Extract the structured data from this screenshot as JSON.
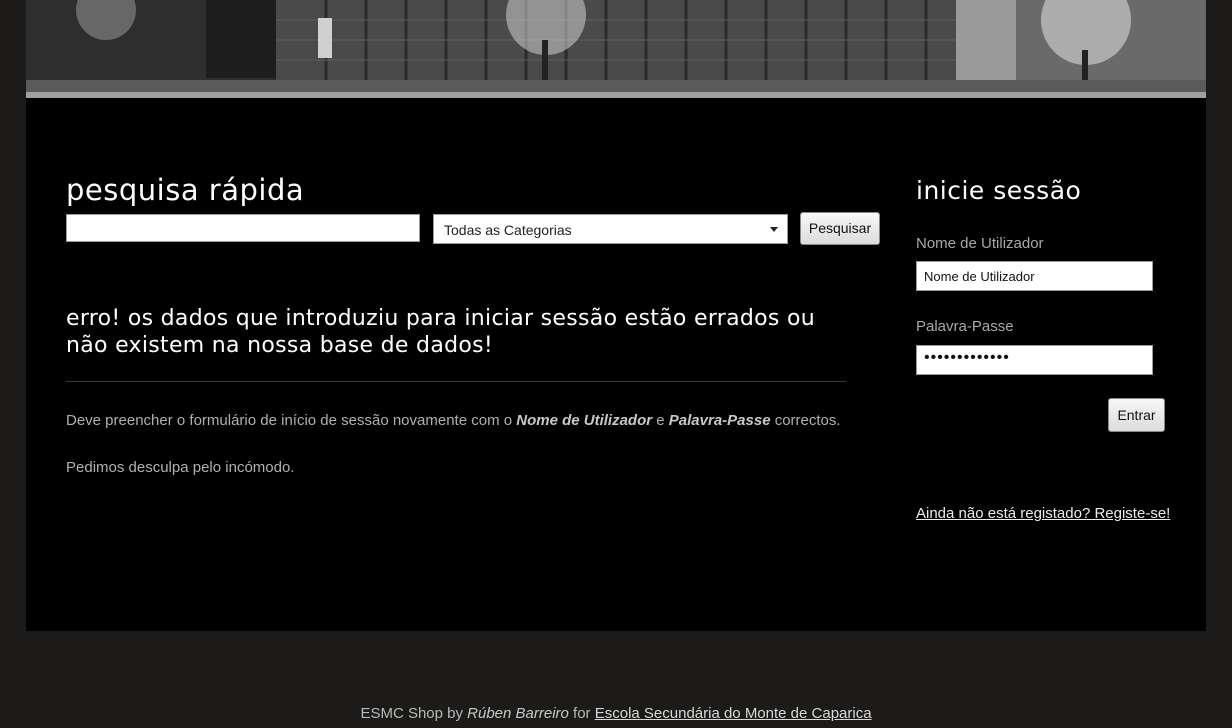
{
  "search": {
    "title": "pesquisa rápida",
    "input_value": "",
    "category_selected": "Todas as Categorias",
    "button_label": "Pesquisar"
  },
  "error": {
    "title": "erro! os dados que introduziu para iniciar sessão estão errados ou não existem na nossa base de dados!",
    "message_prefix": "Deve preencher o formulário de início de sessão novamente com o ",
    "message_term1": "Nome de Utilizador",
    "message_conj": " e ",
    "message_term2": "Palavra-Passe",
    "message_suffix": " correctos.",
    "apology": "Pedimos desculpa pelo incómodo."
  },
  "login": {
    "title": "inicie sessão",
    "username_label": "Nome de Utilizador",
    "username_value": "Nome de Utilizador",
    "password_label": "Palavra-Passe",
    "password_value": "•••••••••••••",
    "enter_label": "Entrar",
    "register_link": "Ainda não está registado? Registe-se!"
  },
  "footer": {
    "shop_name": "ESMC Shop by ",
    "author": "Rúben Barreiro",
    "connector": " for ",
    "school_link": "Escola Secundária do Monte de Caparica"
  }
}
